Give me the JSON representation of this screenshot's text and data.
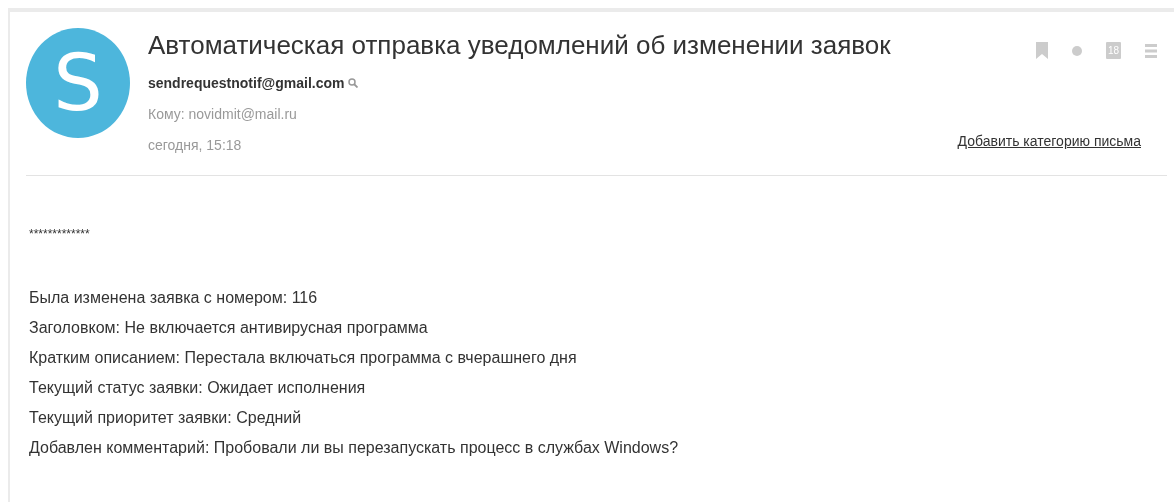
{
  "avatar": {
    "letter": "S",
    "color": "#4db6dc"
  },
  "subject": "Автоматическая отправка уведомлений об изменении заявок",
  "sender": "sendrequestnotif@gmail.com",
  "recipient": "Кому: novidmit@mail.ru",
  "date": "сегодня, 15:18",
  "toolbar": {
    "calendar_day": "18"
  },
  "category_link": "Добавить категорию письма",
  "body": [
    "*************",
    "Была изменена заявка с номером: 116",
    "Заголовком: Не включается антивирусная программа",
    "Кратким описанием: Перестала включаться программа с вчерашнего дня",
    "Текущий статус заявки: Ожидает исполнения",
    "Текущий приоритет заявки: Средний",
    "Добавлен комментарий: Пробовали ли вы перезапускать процесс в службах Windows?"
  ]
}
